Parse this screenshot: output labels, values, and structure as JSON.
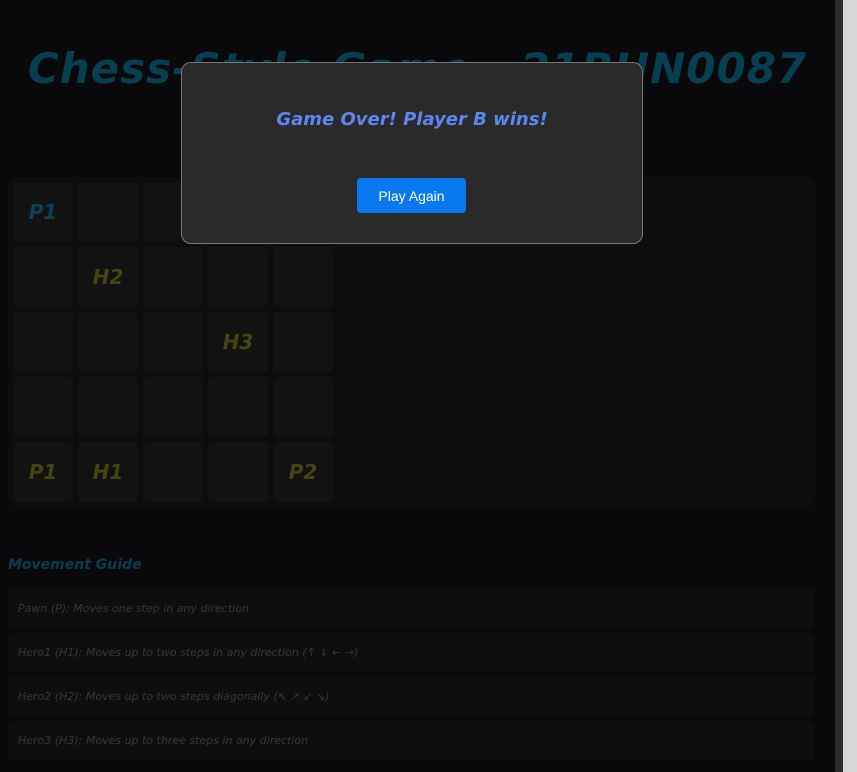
{
  "page": {
    "title": "Chess-Style Game - 21BHN0087"
  },
  "board": {
    "rows": [
      [
        {
          "text": "P1",
          "owner": "A"
        },
        {
          "text": "",
          "owner": ""
        },
        {
          "text": "",
          "owner": ""
        },
        {
          "text": "",
          "owner": ""
        },
        {
          "text": "",
          "owner": ""
        }
      ],
      [
        {
          "text": "",
          "owner": ""
        },
        {
          "text": "H2",
          "owner": "B"
        },
        {
          "text": "",
          "owner": ""
        },
        {
          "text": "",
          "owner": ""
        },
        {
          "text": "",
          "owner": ""
        }
      ],
      [
        {
          "text": "",
          "owner": ""
        },
        {
          "text": "",
          "owner": ""
        },
        {
          "text": "",
          "owner": ""
        },
        {
          "text": "H3",
          "owner": "B"
        },
        {
          "text": "",
          "owner": ""
        }
      ],
      [
        {
          "text": "",
          "owner": ""
        },
        {
          "text": "",
          "owner": ""
        },
        {
          "text": "",
          "owner": ""
        },
        {
          "text": "",
          "owner": ""
        },
        {
          "text": "",
          "owner": ""
        }
      ],
      [
        {
          "text": "P1",
          "owner": "B"
        },
        {
          "text": "H1",
          "owner": "B"
        },
        {
          "text": "",
          "owner": ""
        },
        {
          "text": "",
          "owner": ""
        },
        {
          "text": "P2",
          "owner": "B"
        }
      ]
    ]
  },
  "guide": {
    "title": "Movement Guide",
    "items": [
      "Pawn (P): Moves one step in any direction",
      "Hero1 (H1): Moves up to two steps in any direction (↑ ↓ ← →)",
      "Hero2 (H2): Moves up to two steps diagonally (↖ ↗ ↙ ↘)",
      "Hero3 (H3): Moves up to three steps in any direction"
    ]
  },
  "modal": {
    "message": "Game Over! Player B wins!",
    "button_label": "Play Again"
  },
  "colors": {
    "title": "#0e7ea3",
    "player_a": "#1f7fb0",
    "player_b": "#8a8a20",
    "modal_message": "#5d86f2",
    "button": "#0a78f0"
  }
}
